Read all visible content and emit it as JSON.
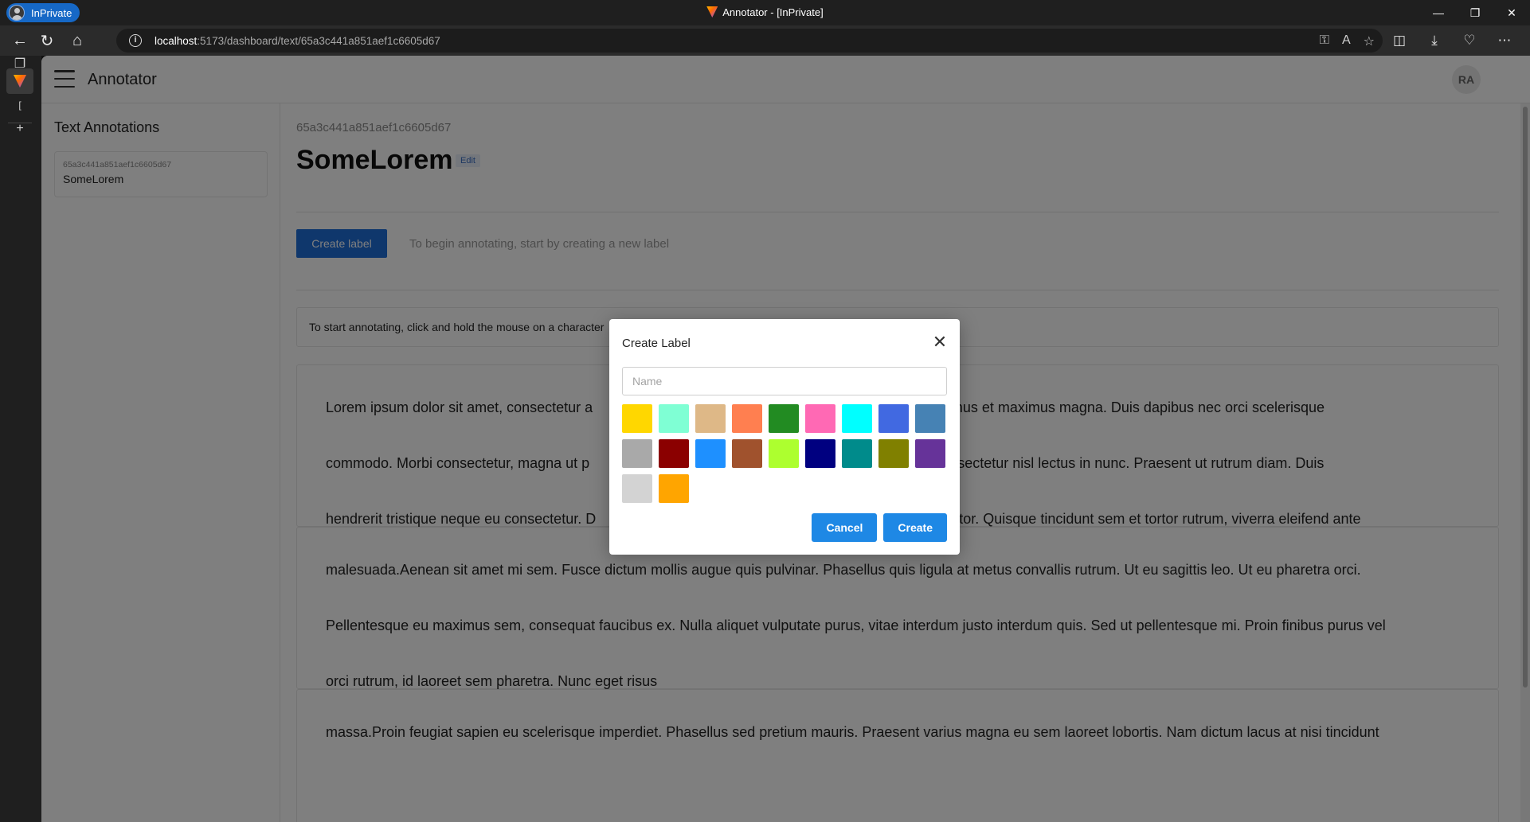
{
  "browser": {
    "inprivate_label": "InPrivate",
    "window_title": "Annotator - [InPrivate]",
    "url_host": "localhost",
    "url_path": ":5173/dashboard/text/65a3c441a851aef1c6605d67"
  },
  "app": {
    "title": "Annotator",
    "avatar_initials": "RA"
  },
  "sidebar": {
    "title": "Text Annotations",
    "documents": [
      {
        "id": "65a3c441a851aef1c6605d67",
        "name": "SomeLorem"
      }
    ]
  },
  "main": {
    "doc_id": "65a3c441a851aef1c6605d67",
    "doc_title": "SomeLorem",
    "edit_label": "Edit",
    "create_label_button": "Create label",
    "hint": "To begin annotating, start by creating a new label",
    "instructions": "To start annotating, click and hold the mouse on a character",
    "paragraphs": [
      "Lorem ipsum dolor sit amet, consectetur a|um. Vivamus et maximus magna. Duis dapibus nec orci scelerisque",
      "commodo. Morbi consectetur, magna ut p|cidunt consectetur nisl lectus in nunc. Praesent ut rutrum diam. Duis",
      "hendrerit tristique neque eu consectetur. D|orper auctor. Quisque tincidunt sem et tortor rutrum, viverra eleifend ante",
      "malesuada.Aenean sit amet mi sem. Fusce dictum mollis augue quis pulvinar. Phasellus quis ligula at metus convallis rutrum. Ut eu sagittis leo. Ut eu pharetra orci.",
      "Pellentesque eu maximus sem, consequat faucibus ex. Nulla aliquet vulputate purus, vitae interdum justo interdum quis. Sed ut pellentesque mi. Proin finibus purus vel",
      "orci rutrum, id laoreet sem pharetra. Nunc eget risus",
      "massa.Proin feugiat sapien eu scelerisque imperdiet. Phasellus sed pretium mauris. Praesent varius magna eu sem laoreet lobortis. Nam dictum lacus at nisi tincidunt"
    ]
  },
  "modal": {
    "title": "Create Label",
    "name_placeholder": "Name",
    "name_value": "",
    "cancel_label": "Cancel",
    "create_label": "Create",
    "colors": [
      "#FFD700",
      "#7FFFD4",
      "#DEB887",
      "#FF7F50",
      "#228B22",
      "#FF69B4",
      "#00FFFF",
      "#4169E1",
      "#4682B4",
      "#A9A9A9",
      "#8B0000",
      "#1E90FF",
      "#A0522D",
      "#ADFF2F",
      "#000080",
      "#008B8B",
      "#808000",
      "#663399",
      "#D3D3D3",
      "#FFA500"
    ]
  }
}
